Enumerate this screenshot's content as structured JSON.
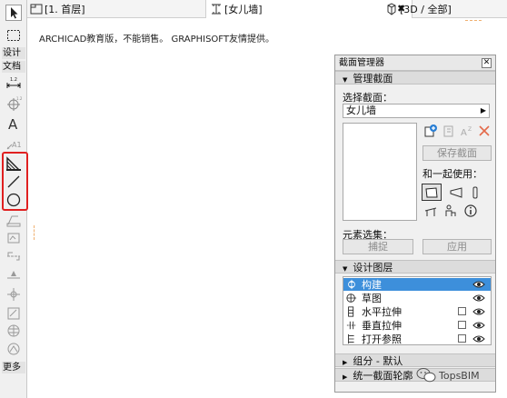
{
  "tabs": [
    {
      "label": "[1. 首层]",
      "icon": "floor-plan-icon"
    },
    {
      "label": "[女儿墙]",
      "icon": "section-icon",
      "active": true
    },
    {
      "label": "[3D / 全部]",
      "icon": "3d-view-icon"
    }
  ],
  "tab_close": "✖",
  "notice": "ARCHICAD教育版，不能销售。 GRAPHISOFT友情提供。",
  "toolbox": {
    "labels": {
      "design": "设计",
      "document": "文档",
      "more": "更多"
    },
    "tools": [
      "arrow-tool-icon",
      "marquee-tool-icon",
      "dimension-icon",
      "level-dimension-icon",
      "text-icon",
      "label-icon",
      "fill-icon",
      "line-icon",
      "circle-icon",
      "polyline-icon",
      "drawing-icon",
      "section-marker-icon",
      "elevation-icon",
      "detail-icon",
      "worksheet-icon",
      "change-icon",
      "interior-elevation-icon",
      "3d-document-icon"
    ]
  },
  "palette": {
    "title": "截面管理器",
    "close": "☒",
    "manage_section": "管理截面",
    "select_section_label": "选择截面：",
    "selected_section": "女儿墙",
    "save_button": "保存截面",
    "use_with_label": "和一起使用：",
    "element_set_label": "元素选集：",
    "capture_button": "捕捉",
    "apply_button": "应用",
    "design_layers": "设计图层",
    "layers": [
      {
        "name": "构建",
        "selected": true,
        "checkbox": false
      },
      {
        "name": "草图",
        "selected": false,
        "checkbox": false
      },
      {
        "name": "水平拉伸",
        "selected": false,
        "checkbox": true
      },
      {
        "name": "垂直拉伸",
        "selected": false,
        "checkbox": true
      },
      {
        "name": "打开参照",
        "selected": false,
        "checkbox": true
      }
    ],
    "group_default": "组分 - 默认",
    "unified_outline": "统一截面轮廓"
  },
  "watermark": "TopsBIM",
  "colors": {
    "highlight": "#e02020",
    "selection": "#3d8fdb",
    "delete_x": "#e36a4a",
    "wechat": "#555555"
  }
}
